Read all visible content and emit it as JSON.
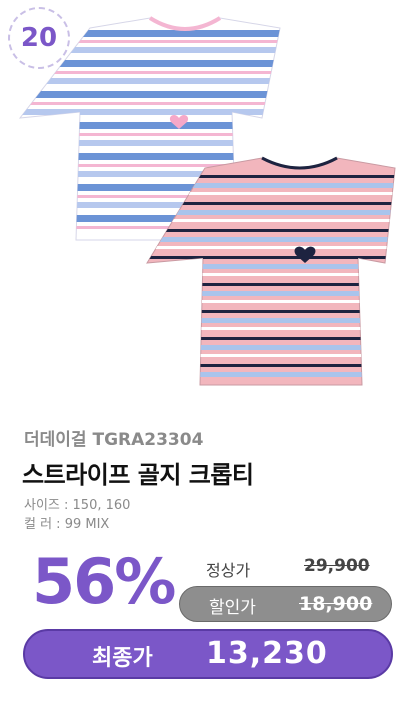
{
  "badge": {
    "number": "20"
  },
  "product": {
    "brand_line": "더데이걸 TGRA23304",
    "title": "스트라이프 골지 크롭티",
    "size_spec": "사이즈 : 150, 160",
    "color_spec": "컬    러 : 99 MIX",
    "image_alt": "두 장의 스트라이프 크롭 티셔츠"
  },
  "pricing": {
    "discount_rate": "56%",
    "regular_label": "정상가",
    "regular_price": "29,900",
    "sale_label": "할인가",
    "sale_price": "18,900",
    "final_label": "최종가",
    "final_price": "13,230"
  },
  "colors": {
    "accent": "#7b57c8",
    "sale_pill": "#8e8e8e"
  }
}
